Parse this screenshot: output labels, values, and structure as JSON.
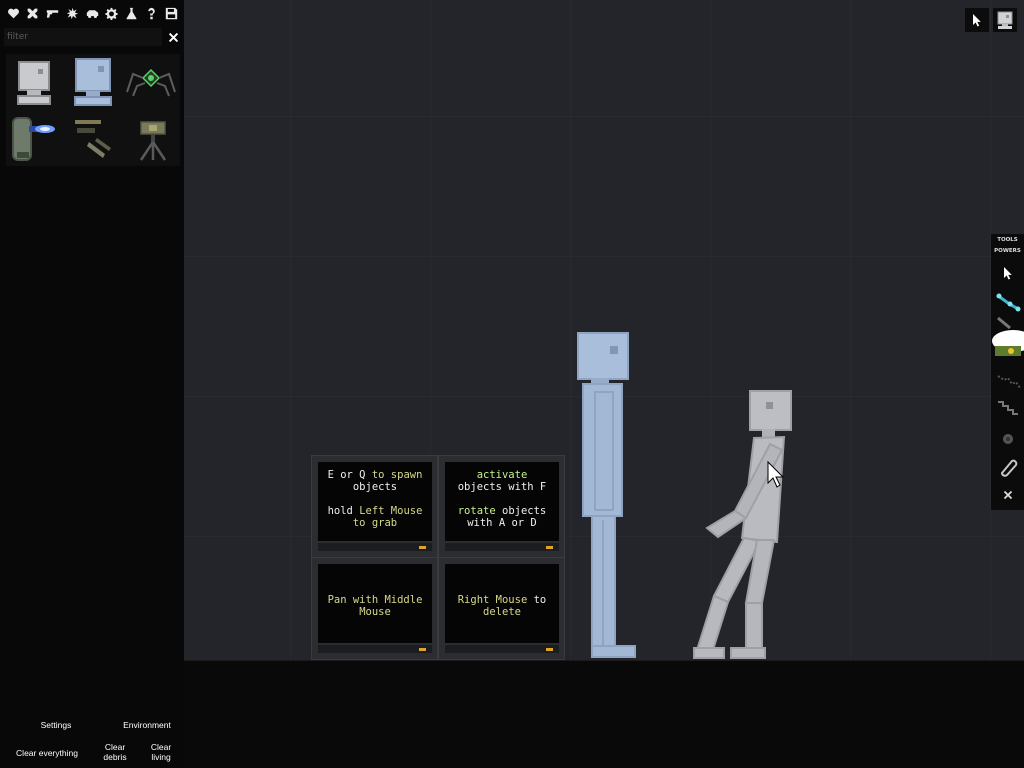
{
  "toolbar": {
    "buttons": [
      {
        "name": "heart-icon"
      },
      {
        "name": "crossed-swords-icon"
      },
      {
        "name": "gun-icon"
      },
      {
        "name": "explosion-icon"
      },
      {
        "name": "vehicle-icon"
      },
      {
        "name": "gear-icon"
      },
      {
        "name": "flask-icon"
      },
      {
        "name": "question-icon"
      },
      {
        "name": "save-icon"
      }
    ]
  },
  "filter": {
    "placeholder": "filter",
    "value": ""
  },
  "catalog": {
    "items": [
      {
        "name": "catalog-item-android"
      },
      {
        "name": "catalog-item-gorse"
      },
      {
        "name": "catalog-item-spider-robot"
      },
      {
        "name": "catalog-item-blaster-cylinder"
      },
      {
        "name": "catalog-item-weapon-parts"
      },
      {
        "name": "catalog-item-turret"
      }
    ]
  },
  "sidebar_bottom": {
    "settings": "Settings",
    "environment": "Environment",
    "clear_everything": "Clear everything",
    "clear_debris_1": "Clear",
    "clear_debris_2": "debris",
    "clear_living_1": "Clear",
    "clear_living_2": "living"
  },
  "tool_panel": {
    "tools_tab": "TOOLS",
    "powers_tab": "POWERS"
  },
  "signs": {
    "r0c0": {
      "line1a": "E or Q",
      "line1b": " to spawn",
      "line2": "objects",
      "line3a": "hold ",
      "line3b": "Left Mouse",
      "line4": "to grab"
    },
    "r0c1": {
      "line1": "activate",
      "line2": "objects with F",
      "line3a": "rotate",
      "line3b": " objects",
      "line4": "with A or D"
    },
    "r1c0": {
      "line1": "Pan with Middle",
      "line2": "Mouse"
    },
    "r1c1": {
      "line1a": "Right Mouse",
      "line1b": " to",
      "line2": "delete"
    }
  },
  "colors": {
    "background": "#24252b",
    "floor": "#090909",
    "sidebar": "#080808",
    "android_blue": "#a7bdd9",
    "human_gray": "#b9bbc0",
    "sign_text_yellow": "#d7d98a",
    "sign_led": "#e0a528"
  }
}
